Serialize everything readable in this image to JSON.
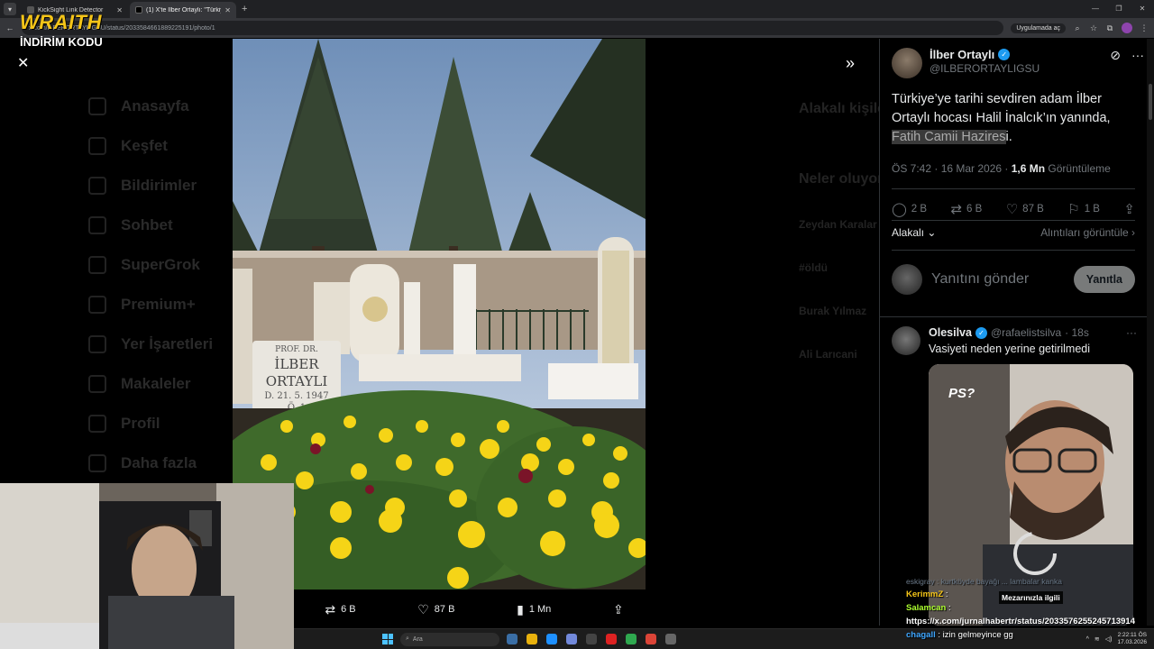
{
  "browser": {
    "tabs": [
      {
        "title": "KickSight Link Detector",
        "active": false
      },
      {
        "title": "(1) X'te İlber Ortaylı: \"Türkiye'y...",
        "active": true
      }
    ],
    "url": "x.com/ILBERORTAYLIGSU/status/2033584661889225191/photo/1",
    "app_pill": "Uygulamada aç"
  },
  "overlay": {
    "brand_line1": "WRAITH",
    "brand_line2": "İNDİRİM KODU"
  },
  "background_nav": [
    "Anasayfa",
    "Keşfet",
    "Bildirimler",
    "Sohbet",
    "SuperGrok",
    "Premium+",
    "Yer İşaretleri",
    "Makaleler",
    "Profil",
    "Daha fazla"
  ],
  "background_right": [
    "Alakalı kişiler",
    "Neler oluyor",
    "Zeydan Karalar",
    "#öldü",
    "Burak Yılmaz",
    "Ali Larıcani"
  ],
  "photo_actions": {
    "retweets": "6 B",
    "likes": "87 B",
    "views": "1 Mn"
  },
  "tweet": {
    "author_name": "İlber Ortaylı",
    "author_handle": "@ILBERORTAYLIGSU",
    "text_main": "Türkiye’ye tarihi sevdiren adam İlber Ortaylı hocası Halil İnalcık’ın yanında, ",
    "text_highlight": "Fatih Camii Hazires",
    "text_end": "i.",
    "time": "ÖS 7:42 · 16 Mar 2026 · ",
    "views_count": "1,6 Mn",
    "views_label": " Görüntüleme",
    "stats": {
      "replies": "2 B",
      "retweets": "6 B",
      "likes": "87 B",
      "bookmarks": "1 B"
    },
    "related_label": "Alakalı",
    "quotes_label": "Alıntıları görüntüle"
  },
  "reply": {
    "placeholder": "Yanıtını gönder",
    "button": "Yanıtla"
  },
  "reply_tweet": {
    "name": "Olesilva",
    "handle": "@rafaelistsilva",
    "time": "· 18s",
    "text": "Vasiyeti neden yerine getirilmedi",
    "media_badge": "PS?"
  },
  "chat": {
    "faded_line": "eskigray : kurtköyde bayağı ... lambalar kanka",
    "caption": "Mezarınızla ilgili",
    "lines": [
      {
        "user": "KerimmZ",
        "text": ""
      },
      {
        "user": "Salamcan",
        "text": ""
      },
      {
        "user": "",
        "text": "https://x.com/jurnalhabertr/status/2033576255245713914"
      },
      {
        "user": "chagall",
        "text": "izin gelmeyince gg"
      }
    ]
  },
  "taskbar": {
    "search": "Ara",
    "time": "2:22:11 ÖS",
    "date": "17.03.2026"
  },
  "colors": {
    "accent": "#1d9bf0",
    "brand": "#f5c518",
    "panel_bg": "#000000",
    "muted": "#71767b"
  }
}
